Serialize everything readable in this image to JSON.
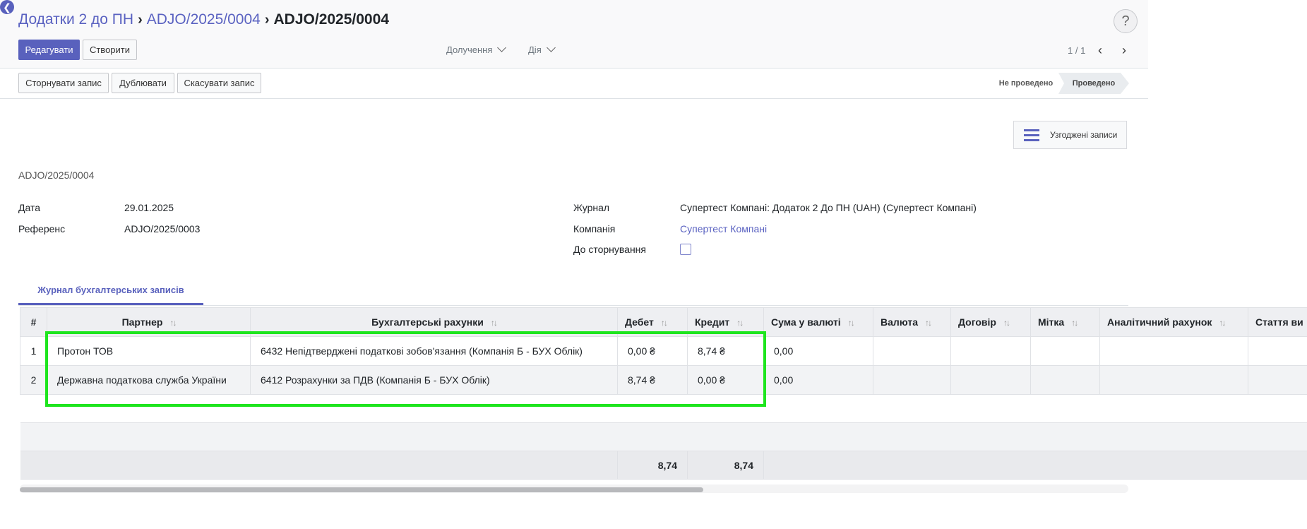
{
  "breadcrumb": {
    "parent": "Додатки 2 до ПН",
    "middle": "ADJO/2025/0004",
    "current": "ADJO/2025/0004"
  },
  "help": "?",
  "toolbar": {
    "edit_label": "Редагувати",
    "create_label": "Створити",
    "print_label": "Долучення",
    "action_label": "Дія"
  },
  "pager": {
    "value": "1 / 1"
  },
  "header_buttons": {
    "reverse": "Сторнувати запис",
    "duplicate": "Дублювати",
    "cancel": "Скасувати запис"
  },
  "status": {
    "draft": "Не проведено",
    "posted": "Проведено",
    "current": "Проведено"
  },
  "smart_button": {
    "label": "Узгоджені записи",
    "icon": "list-icon"
  },
  "record": {
    "name": "ADJO/2025/0004"
  },
  "fields": {
    "date_label": "Дата",
    "date_value": "29.01.2025",
    "ref_label": "Референс",
    "ref_value": "ADJO/2025/0003",
    "journal_label": "Журнал",
    "journal_value": "Супертест Компані: Додаток 2 До ПН (UAH) (Супертест Компані)",
    "company_label": "Компанія",
    "company_value": "Супертест Компані",
    "to_reverse_label": "До сторнування",
    "to_reverse_checked": false
  },
  "tabs": [
    {
      "label": "Журнал бухгалтерських записів",
      "active": true
    }
  ],
  "table": {
    "columns": [
      "#",
      "Партнер",
      "Бухгалтерські рахунки",
      "Дебет",
      "Кредит",
      "Сума у валюті",
      "Валюта",
      "Договір",
      "Мітка",
      "Аналітичний рахунок",
      "Стаття ви"
    ],
    "rows": [
      {
        "n": "1",
        "partner": "Протон ТОВ",
        "account": "6432 Непідтверджені податкові зобов'язання (Компанія Б - БУХ Облік)",
        "debit": "0,00 ₴",
        "credit": "8,74 ₴",
        "amount_currency": "0,00"
      },
      {
        "n": "2",
        "partner": "Державна податкова служба України",
        "account": "6412 Розрахунки за ПДВ (Компанія Б - БУХ Облік)",
        "debit": "8,74 ₴",
        "credit": "0,00 ₴",
        "amount_currency": "0,00"
      }
    ],
    "totals": {
      "debit": "8,74",
      "credit": "8,74"
    }
  },
  "colors": {
    "accent": "#5961bd",
    "highlight": "#1ee51e"
  }
}
